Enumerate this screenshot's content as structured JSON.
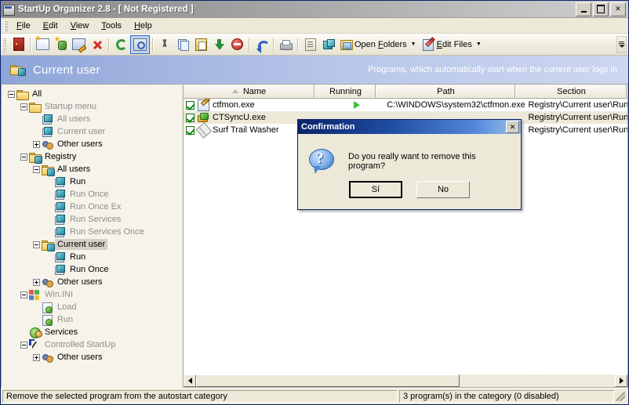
{
  "window": {
    "title": "StartUp Organizer 2.8 - [ Not Registered ]",
    "icon": "app-icon",
    "minimize_label": "_",
    "maximize_label": "□",
    "close_label": "✕"
  },
  "menubar": {
    "items": [
      {
        "label": "File",
        "accel": "F"
      },
      {
        "label": "Edit",
        "accel": "E"
      },
      {
        "label": "View",
        "accel": "V"
      },
      {
        "label": "Tools",
        "accel": "T"
      },
      {
        "label": "Help",
        "accel": "H"
      }
    ]
  },
  "toolbar": {
    "buttons": [
      {
        "name": "exit-icon",
        "tooltip": "Exit"
      },
      {
        "name": "new-category-icon",
        "tooltip": "New"
      },
      {
        "name": "new-user-icon",
        "tooltip": "New user"
      },
      {
        "name": "edit-program-icon",
        "tooltip": "Edit"
      },
      {
        "name": "delete-icon",
        "tooltip": "Delete"
      },
      {
        "name": "refresh-icon",
        "tooltip": "Refresh"
      },
      {
        "name": "find-icon",
        "tooltip": "Find",
        "pressed": true
      },
      {
        "name": "cut-icon",
        "tooltip": "Cut"
      },
      {
        "name": "copy-icon",
        "tooltip": "Copy"
      },
      {
        "name": "paste-icon",
        "tooltip": "Paste"
      },
      {
        "name": "move-down-icon",
        "tooltip": "Move down"
      },
      {
        "name": "disable-icon",
        "tooltip": "Disable"
      },
      {
        "name": "undo-icon",
        "tooltip": "Undo"
      },
      {
        "name": "print-icon",
        "tooltip": "Print"
      },
      {
        "name": "report-icon",
        "tooltip": "Report"
      },
      {
        "name": "registry-icon",
        "tooltip": "Registry"
      }
    ],
    "open_folders": {
      "label": "Open Folders",
      "accel": "F",
      "caret": "▾"
    },
    "edit_files": {
      "label": "Edit Files",
      "accel": "E",
      "caret": "▾"
    },
    "overflow": "≡"
  },
  "banner": {
    "icon": "folder-registry-icon",
    "title": "Current user",
    "description": "Programs, which automatically start when the current user logs in"
  },
  "tree": {
    "nodes": [
      {
        "label": "All",
        "depth": 0,
        "toggle": "minus",
        "icon": "folder-icon",
        "dim": false,
        "selected": false
      },
      {
        "label": "Startup menu",
        "depth": 1,
        "toggle": "minus",
        "icon": "folder-icon",
        "dim": true,
        "selected": false
      },
      {
        "label": "All users",
        "depth": 2,
        "toggle": "none",
        "icon": "startup-folder-icon",
        "dim": true,
        "selected": false
      },
      {
        "label": "Current user",
        "depth": 2,
        "toggle": "none",
        "icon": "startup-folder-icon",
        "dim": true,
        "selected": false
      },
      {
        "label": "Other users",
        "depth": 2,
        "toggle": "plus",
        "icon": "users-icon",
        "dim": false,
        "selected": false
      },
      {
        "label": "Registry",
        "depth": 1,
        "toggle": "minus",
        "icon": "folder-registry-icon",
        "dim": false,
        "selected": false
      },
      {
        "label": "All users",
        "depth": 2,
        "toggle": "minus",
        "icon": "folder-registry-icon",
        "dim": false,
        "selected": false
      },
      {
        "label": "Run",
        "depth": 3,
        "toggle": "none",
        "icon": "registry-key-icon",
        "dim": false,
        "selected": false
      },
      {
        "label": "Run Once",
        "depth": 3,
        "toggle": "none",
        "icon": "registry-key-icon",
        "dim": true,
        "selected": false
      },
      {
        "label": "Run Once Ex",
        "depth": 3,
        "toggle": "none",
        "icon": "registry-key-icon",
        "dim": true,
        "selected": false
      },
      {
        "label": "Run Services",
        "depth": 3,
        "toggle": "none",
        "icon": "registry-key-icon",
        "dim": true,
        "selected": false
      },
      {
        "label": "Run Services Once",
        "depth": 3,
        "toggle": "none",
        "icon": "registry-key-icon",
        "dim": true,
        "selected": false
      },
      {
        "label": "Current user",
        "depth": 2,
        "toggle": "minus",
        "icon": "folder-registry-icon",
        "dim": false,
        "selected": true
      },
      {
        "label": "Run",
        "depth": 3,
        "toggle": "none",
        "icon": "registry-key-icon",
        "dim": false,
        "selected": false
      },
      {
        "label": "Run Once",
        "depth": 3,
        "toggle": "none",
        "icon": "registry-key-icon",
        "dim": false,
        "selected": false
      },
      {
        "label": "Other users",
        "depth": 2,
        "toggle": "plus",
        "icon": "users-icon",
        "dim": false,
        "selected": false
      },
      {
        "label": "Win.INI",
        "depth": 1,
        "toggle": "minus",
        "icon": "windows-icon",
        "dim": true,
        "selected": false
      },
      {
        "label": "Load",
        "depth": 2,
        "toggle": "none",
        "icon": "ini-file-icon",
        "dim": true,
        "selected": false
      },
      {
        "label": "Run",
        "depth": 2,
        "toggle": "none",
        "icon": "ini-file-icon",
        "dim": true,
        "selected": false
      },
      {
        "label": "Services",
        "depth": 1,
        "toggle": "none",
        "icon": "services-icon",
        "dim": false,
        "selected": false
      },
      {
        "label": "Controlled StartUp",
        "depth": 1,
        "toggle": "minus",
        "icon": "cursor-icon",
        "dim": true,
        "selected": false
      },
      {
        "label": "Other users",
        "depth": 2,
        "toggle": "plus",
        "icon": "users-icon",
        "dim": false,
        "selected": false
      }
    ]
  },
  "list": {
    "columns": [
      {
        "key": "name",
        "label": "Name",
        "sorted": "asc",
        "sort_glyph": "△"
      },
      {
        "key": "running",
        "label": "Running"
      },
      {
        "key": "path",
        "label": "Path"
      },
      {
        "key": "section",
        "label": "Section"
      }
    ],
    "rows": [
      {
        "checked": true,
        "icon": "edit-file-icon",
        "name": "ctfmon.exe",
        "running": true,
        "running_glyph": "▶",
        "path": "C:\\WINDOWS\\system32\\ctfmon.exe",
        "section": "Registry\\Current user\\Run",
        "selected": false
      },
      {
        "checked": true,
        "icon": "sync-icon",
        "name": "CTSyncU.exe",
        "running": false,
        "running_glyph": "",
        "path": "",
        "section": "Registry\\Current user\\Run",
        "selected": true
      },
      {
        "checked": true,
        "icon": "brush-icon",
        "name": "Surf Trail Washer",
        "running": false,
        "running_glyph": "",
        "path": "",
        "section": "Registry\\Current user\\Run",
        "selected": false
      }
    ],
    "hscrollbar": {
      "left_arrow": "◀",
      "right_arrow": "▶"
    }
  },
  "dialog": {
    "title": "Confirmation",
    "close_label": "✕",
    "icon": "question-icon",
    "icon_glyph": "?",
    "message": "Do you really want to remove this program?",
    "buttons": [
      {
        "label": "Sí",
        "default": true,
        "name": "yes-button"
      },
      {
        "label": "No",
        "default": false,
        "name": "no-button"
      }
    ]
  },
  "statusbar": {
    "hint": "Remove the selected program from the autostart category",
    "count": "3 program(s) in the category (0 disabled)"
  },
  "colors": {
    "titlebar_inactive": "#9e9e9e",
    "banner_start": "#8ca4d8",
    "banner_end": "#ccd6f0",
    "dialog_title": "#0a246a",
    "checkbox_green": "#0a8a0a",
    "running_green": "#3fbf3f",
    "face": "#ece9d8",
    "tree_bg": "#f5f3ea"
  }
}
